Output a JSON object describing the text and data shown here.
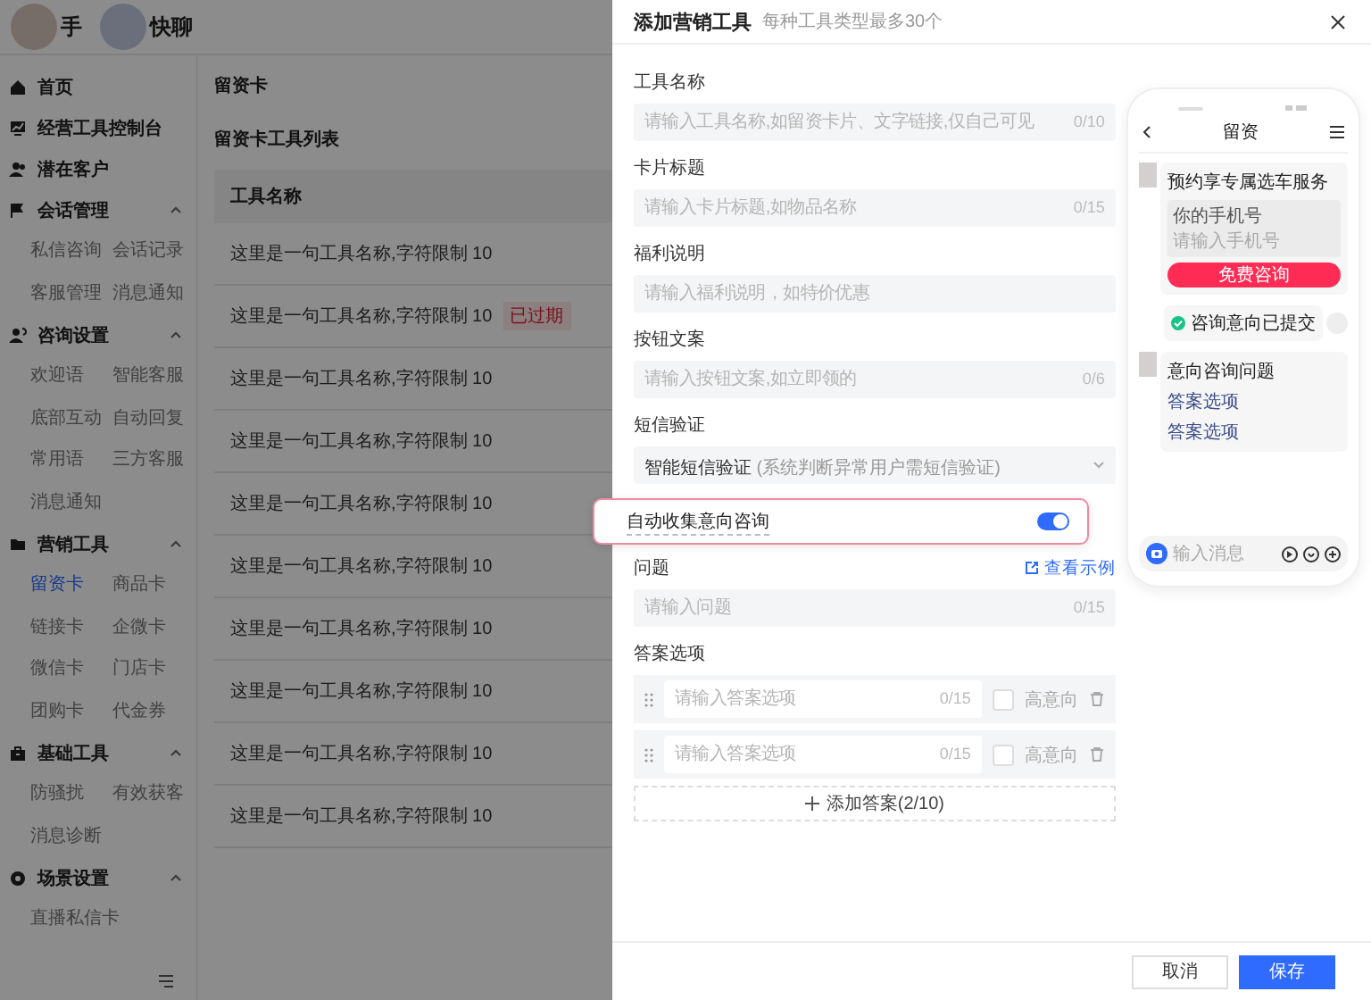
{
  "header": {
    "brand_left": "手",
    "brand_right": "快聊"
  },
  "sidebar": {
    "groups": [
      {
        "label": "首页",
        "selected": false
      },
      {
        "label": "经营工具控制台",
        "selected": false
      },
      {
        "label": "潜在客户",
        "selected": false
      },
      {
        "label": "会话管理",
        "expanded": true,
        "children": [
          {
            "label": "私信咨询",
            "selected": false
          },
          {
            "label": "会话记录",
            "selected": false
          },
          {
            "label": "客服管理",
            "selected": false
          },
          {
            "label": "消息通知",
            "selected": false
          }
        ]
      },
      {
        "label": "咨询设置",
        "expanded": true,
        "children": [
          {
            "label": "欢迎语",
            "selected": false
          },
          {
            "label": "智能客服",
            "selected": false
          },
          {
            "label": "底部互动",
            "selected": false
          },
          {
            "label": "自动回复",
            "selected": false
          },
          {
            "label": "常用语",
            "selected": false
          },
          {
            "label": "三方客服",
            "selected": false
          },
          {
            "label": "消息通知",
            "selected": false
          }
        ]
      },
      {
        "label": "营销工具",
        "expanded": true,
        "children": [
          {
            "label": "留资卡",
            "selected": true
          },
          {
            "label": "商品卡",
            "selected": false
          },
          {
            "label": "链接卡",
            "selected": false
          },
          {
            "label": "企微卡",
            "selected": false
          },
          {
            "label": "微信卡",
            "selected": false
          },
          {
            "label": "门店卡",
            "selected": false
          },
          {
            "label": "团购卡",
            "selected": false
          },
          {
            "label": "代金券",
            "selected": false
          }
        ]
      },
      {
        "label": "基础工具",
        "expanded": true,
        "children": [
          {
            "label": "防骚扰",
            "selected": false
          },
          {
            "label": "有效获客",
            "selected": false
          },
          {
            "label": "消息诊断",
            "selected": false
          }
        ]
      },
      {
        "label": "场景设置",
        "expanded": true,
        "children": [
          {
            "label": "直播私信卡",
            "selected": false
          }
        ]
      }
    ]
  },
  "page": {
    "title": "留资卡",
    "list_title": "留资卡工具列表",
    "column_1": "工具名称",
    "rows": [
      {
        "name": "这里是一句工具名称,字符限制 10"
      },
      {
        "name": "这里是一句工具名称,字符限制 10",
        "tag": "已过期"
      },
      {
        "name": "这里是一句工具名称,字符限制 10"
      },
      {
        "name": "这里是一句工具名称,字符限制 10"
      },
      {
        "name": "这里是一句工具名称,字符限制 10"
      },
      {
        "name": "这里是一句工具名称,字符限制 10"
      },
      {
        "name": "这里是一句工具名称,字符限制 10"
      },
      {
        "name": "这里是一句工具名称,字符限制 10"
      },
      {
        "name": "这里是一句工具名称,字符限制 10"
      },
      {
        "name": "这里是一句工具名称,字符限制 10"
      }
    ]
  },
  "drawer": {
    "title": "添加营销工具",
    "subtitle": "每种工具类型最多30个",
    "fields": [
      {
        "kind": "input",
        "label": "工具名称",
        "placeholder": "请输入工具名称,如留资卡片、文字链接,仅自己可见",
        "counter": "0/10"
      },
      {
        "kind": "input",
        "label": "卡片标题",
        "placeholder": "请输入卡片标题,如物品名称",
        "counter": "0/15"
      },
      {
        "kind": "input",
        "label": "福利说明",
        "placeholder": "请输入福利说明，如特价优惠"
      },
      {
        "kind": "input",
        "label": "按钮文案",
        "placeholder": "请输入按钮文案,如立即领的",
        "counter": "0/6"
      },
      {
        "kind": "select",
        "label": "短信验证",
        "value": "智能短信验证",
        "hint": "(系统判断异常用户需短信验证)"
      },
      {
        "kind": "switch",
        "label": "自动收集意向咨询",
        "on": true,
        "highlighted": true
      },
      {
        "kind": "input",
        "label": "问题",
        "link": "查看示例",
        "placeholder": "请输入问题",
        "counter": "0/15"
      },
      {
        "kind": "options",
        "label": "答案选项",
        "options": [
          {
            "placeholder": "请输入答案选项",
            "counter": "0/15",
            "checked": false,
            "check_label": "高意向"
          },
          {
            "placeholder": "请输入答案选项",
            "counter": "0/15",
            "checked": false,
            "check_label": "高意向"
          }
        ],
        "add_button": "添加答案(2/10)"
      }
    ],
    "preview": {
      "title": "留资",
      "form_heading": "预约享专属选车服务",
      "field_label": "你的手机号",
      "field_placeholder": "请输入手机号",
      "form_button": "免费咨询",
      "submitted": "咨询意向已提交",
      "question_heading": "意向咨询问题",
      "answers": [
        "答案选项",
        "答案选项"
      ],
      "input_placeholder": "输入消息"
    },
    "buttons": [
      {
        "kind": "secondary",
        "label": "取消"
      },
      {
        "kind": "primary",
        "label": "保存"
      }
    ]
  }
}
